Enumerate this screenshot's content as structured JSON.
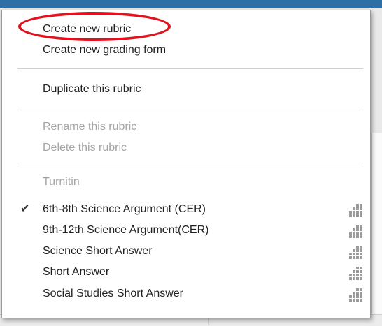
{
  "menu": {
    "section_create": [
      {
        "label": "Create new rubric"
      },
      {
        "label": "Create new grading form"
      }
    ],
    "section_duplicate": [
      {
        "label": "Duplicate this rubric"
      }
    ],
    "section_manage": [
      {
        "label": "Rename this rubric",
        "disabled": true
      },
      {
        "label": "Delete this rubric",
        "disabled": true
      }
    ],
    "turnitin_header": "Turnitin",
    "rubrics": [
      {
        "label": "6th-8th Science Argument (CER)",
        "checked": true,
        "icon": "grid-icon"
      },
      {
        "label": "9th-12th Science Argument(CER)",
        "checked": false,
        "icon": "grid-icon"
      },
      {
        "label": "Science Short Answer",
        "checked": false,
        "icon": "grid-icon"
      },
      {
        "label": "Short Answer",
        "checked": false,
        "icon": "grid-icon"
      },
      {
        "label": "Social Studies Short Answer",
        "checked": false,
        "icon": "grid-icon"
      }
    ],
    "check_glyph": "✔"
  },
  "colors": {
    "annotation": "#e0121e",
    "disabled_text": "#a4a4a4",
    "header_strip": "#2f6fa8"
  }
}
